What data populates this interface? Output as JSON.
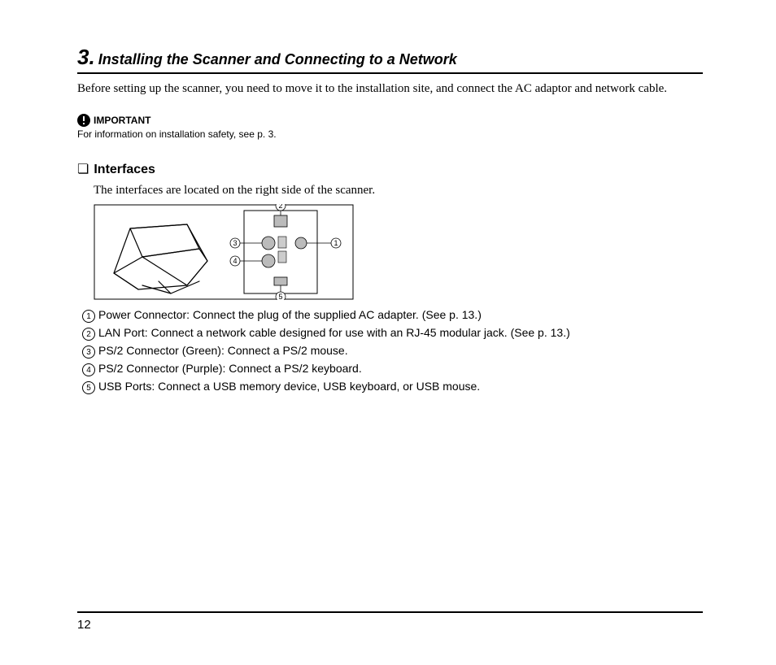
{
  "section": {
    "number": "3.",
    "title": "Installing the Scanner and Connecting to a Network",
    "intro": "Before setting up the scanner, you need to move it to the installation site, and connect the AC adaptor and network cable."
  },
  "important": {
    "label": "IMPORTANT",
    "text": "For information on installation safety, see p. 3."
  },
  "interfaces": {
    "heading": "Interfaces",
    "intro": "The interfaces are located on the right side of the scanner.",
    "callouts": [
      {
        "num": "1",
        "text": "Power Connector: Connect the plug of the supplied AC adapter. (See p. 13.)"
      },
      {
        "num": "2",
        "text": "LAN Port: Connect a network cable designed for use with an RJ-45 modular jack. (See p. 13.)"
      },
      {
        "num": "3",
        "text": "PS/2 Connector (Green): Connect a PS/2 mouse."
      },
      {
        "num": "4",
        "text": "PS/2 Connector (Purple): Connect a PS/2 keyboard."
      },
      {
        "num": "5",
        "text": "USB Ports: Connect a USB memory device, USB keyboard, or USB mouse."
      }
    ]
  },
  "pageNumber": "12"
}
